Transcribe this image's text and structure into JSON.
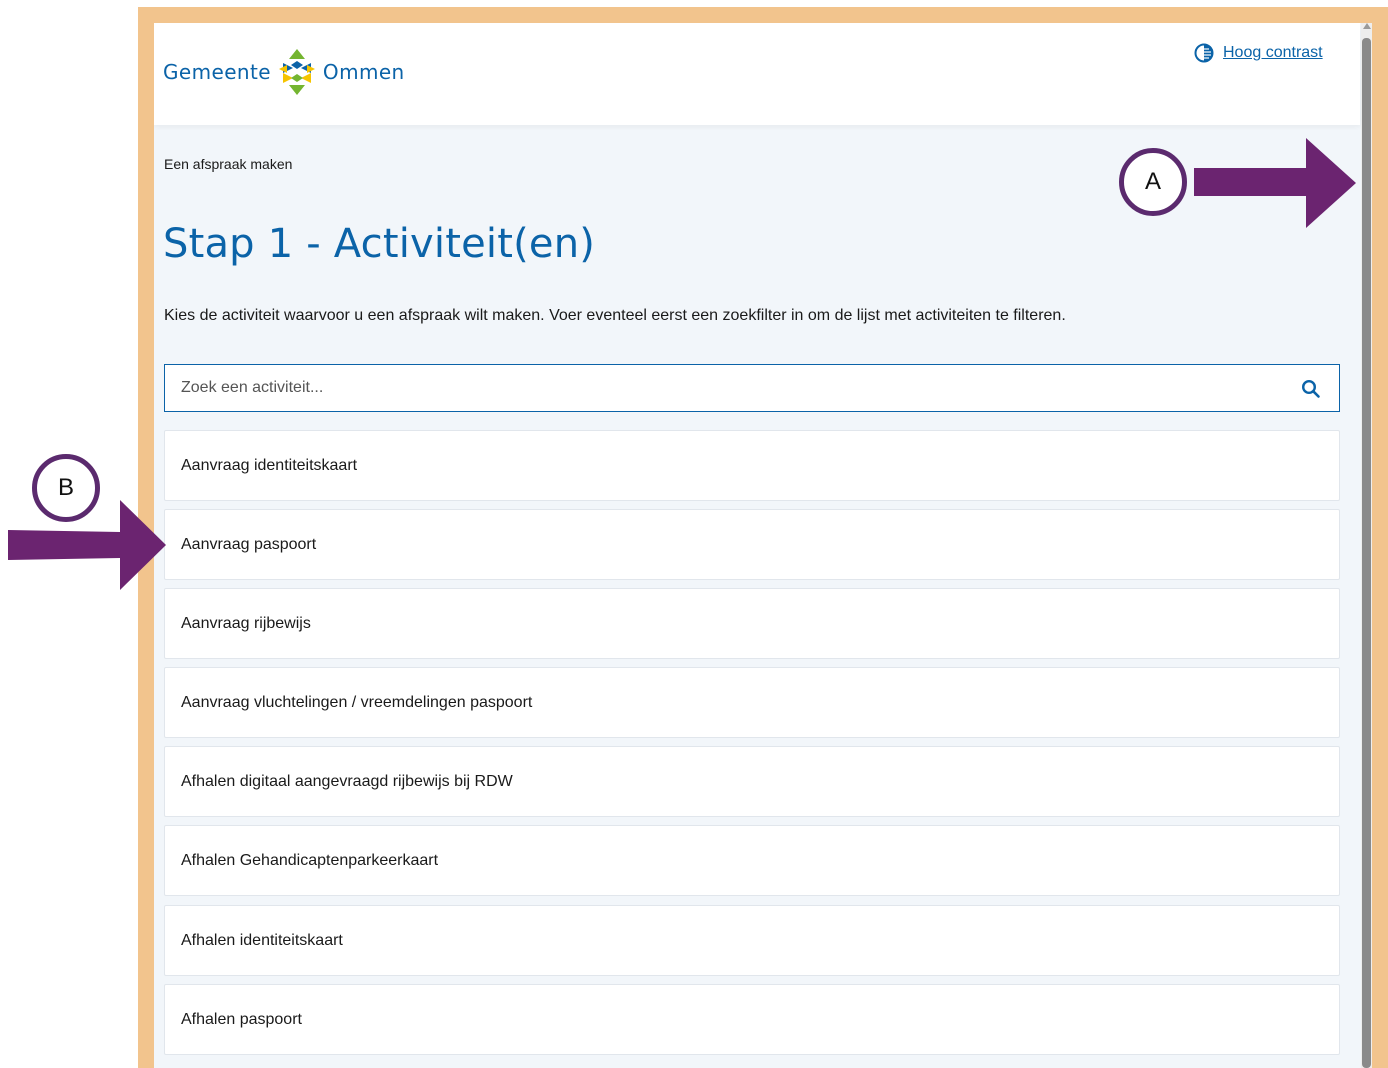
{
  "header": {
    "logo": {
      "word_left": "Gemeente",
      "word_right": "Ommen"
    },
    "contrast_link": "Hoog contrast"
  },
  "breadcrumb": "Een afspraak maken",
  "page_title": "Stap 1 - Activiteit(en)",
  "intro": "Kies de activiteit waarvoor u een afspraak wilt maken. Voer eventeel eerst een zoekfilter in om de lijst met activiteiten te filteren.",
  "search": {
    "placeholder": "Zoek een activiteit...",
    "value": ""
  },
  "activities": [
    "Aanvraag identiteitskaart",
    "Aanvraag paspoort",
    "Aanvraag rijbewijs",
    "Aanvraag vluchtelingen / vreemdelingen paspoort",
    "Afhalen digitaal aangevraagd rijbewijs bij RDW",
    "Afhalen Gehandicaptenparkeerkaart",
    "Afhalen identiteitskaart",
    "Afhalen paspoort"
  ],
  "annotations": {
    "a": "A",
    "b": "B"
  },
  "colors": {
    "brand_blue": "#0b63a8",
    "frame": "#f2c48d",
    "annotation_purple": "#6b2470"
  },
  "icons": [
    "contrast-icon",
    "search-icon",
    "arrow-right-icon"
  ]
}
